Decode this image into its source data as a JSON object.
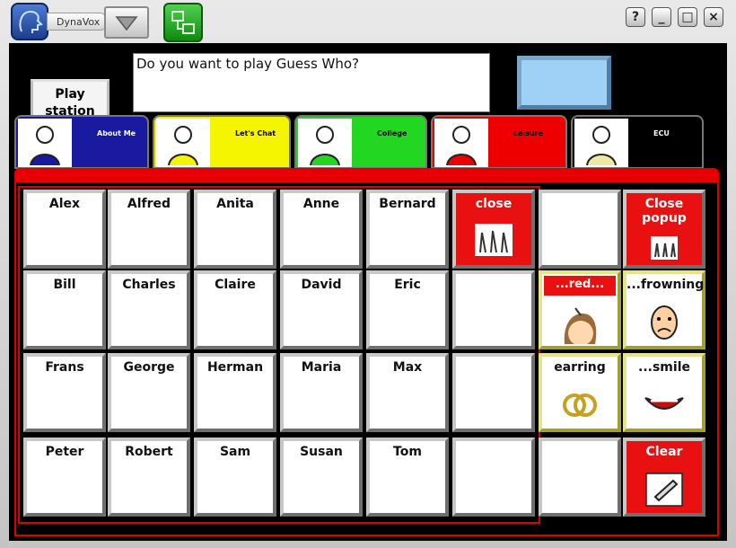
{
  "header": {
    "logo_text": "DynaVox",
    "window_buttons": [
      "?",
      "_",
      "□",
      "×"
    ]
  },
  "play_button": {
    "line1": "Play",
    "line2": "station"
  },
  "message": {
    "text": "Do you want to play Guess Who?"
  },
  "tabs": [
    {
      "label": "About Me",
      "bg": "#1a1aa0",
      "fg": "#ffffff",
      "icon": "person-icon"
    },
    {
      "label": "Let's Chat",
      "bg": "#f5f500",
      "fg": "#000000",
      "icon": "people-chat-icon"
    },
    {
      "label": "College",
      "bg": "#22d622",
      "fg": "#000000",
      "icon": "math-book-icon"
    },
    {
      "label": "Leisure",
      "bg": "#ee0000",
      "fg": "#000000",
      "icon": "sports-icon"
    },
    {
      "label": "ECU",
      "bg": "#000000",
      "fg": "#ffffff",
      "icon": "relax-icon"
    }
  ],
  "names": [
    [
      "Alex",
      "Alfred",
      "Anita",
      "Anne",
      "Bernard"
    ],
    [
      "Bill",
      "Charles",
      "Claire",
      "David",
      "Eric"
    ],
    [
      "Frans",
      "George",
      "Herman",
      "Maria",
      "Max"
    ],
    [
      "Peter",
      "Robert",
      "Sam",
      "Susan",
      "Tom"
    ]
  ],
  "close_cell": "close",
  "popup": {
    "close_popup": "Close popup",
    "red": "...red...",
    "frowning": "...frowning",
    "earring": "earring",
    "smile": "...smile",
    "clear": "Clear"
  },
  "colors": {
    "accent_red": "#e81010",
    "work_bg": "#000000"
  }
}
